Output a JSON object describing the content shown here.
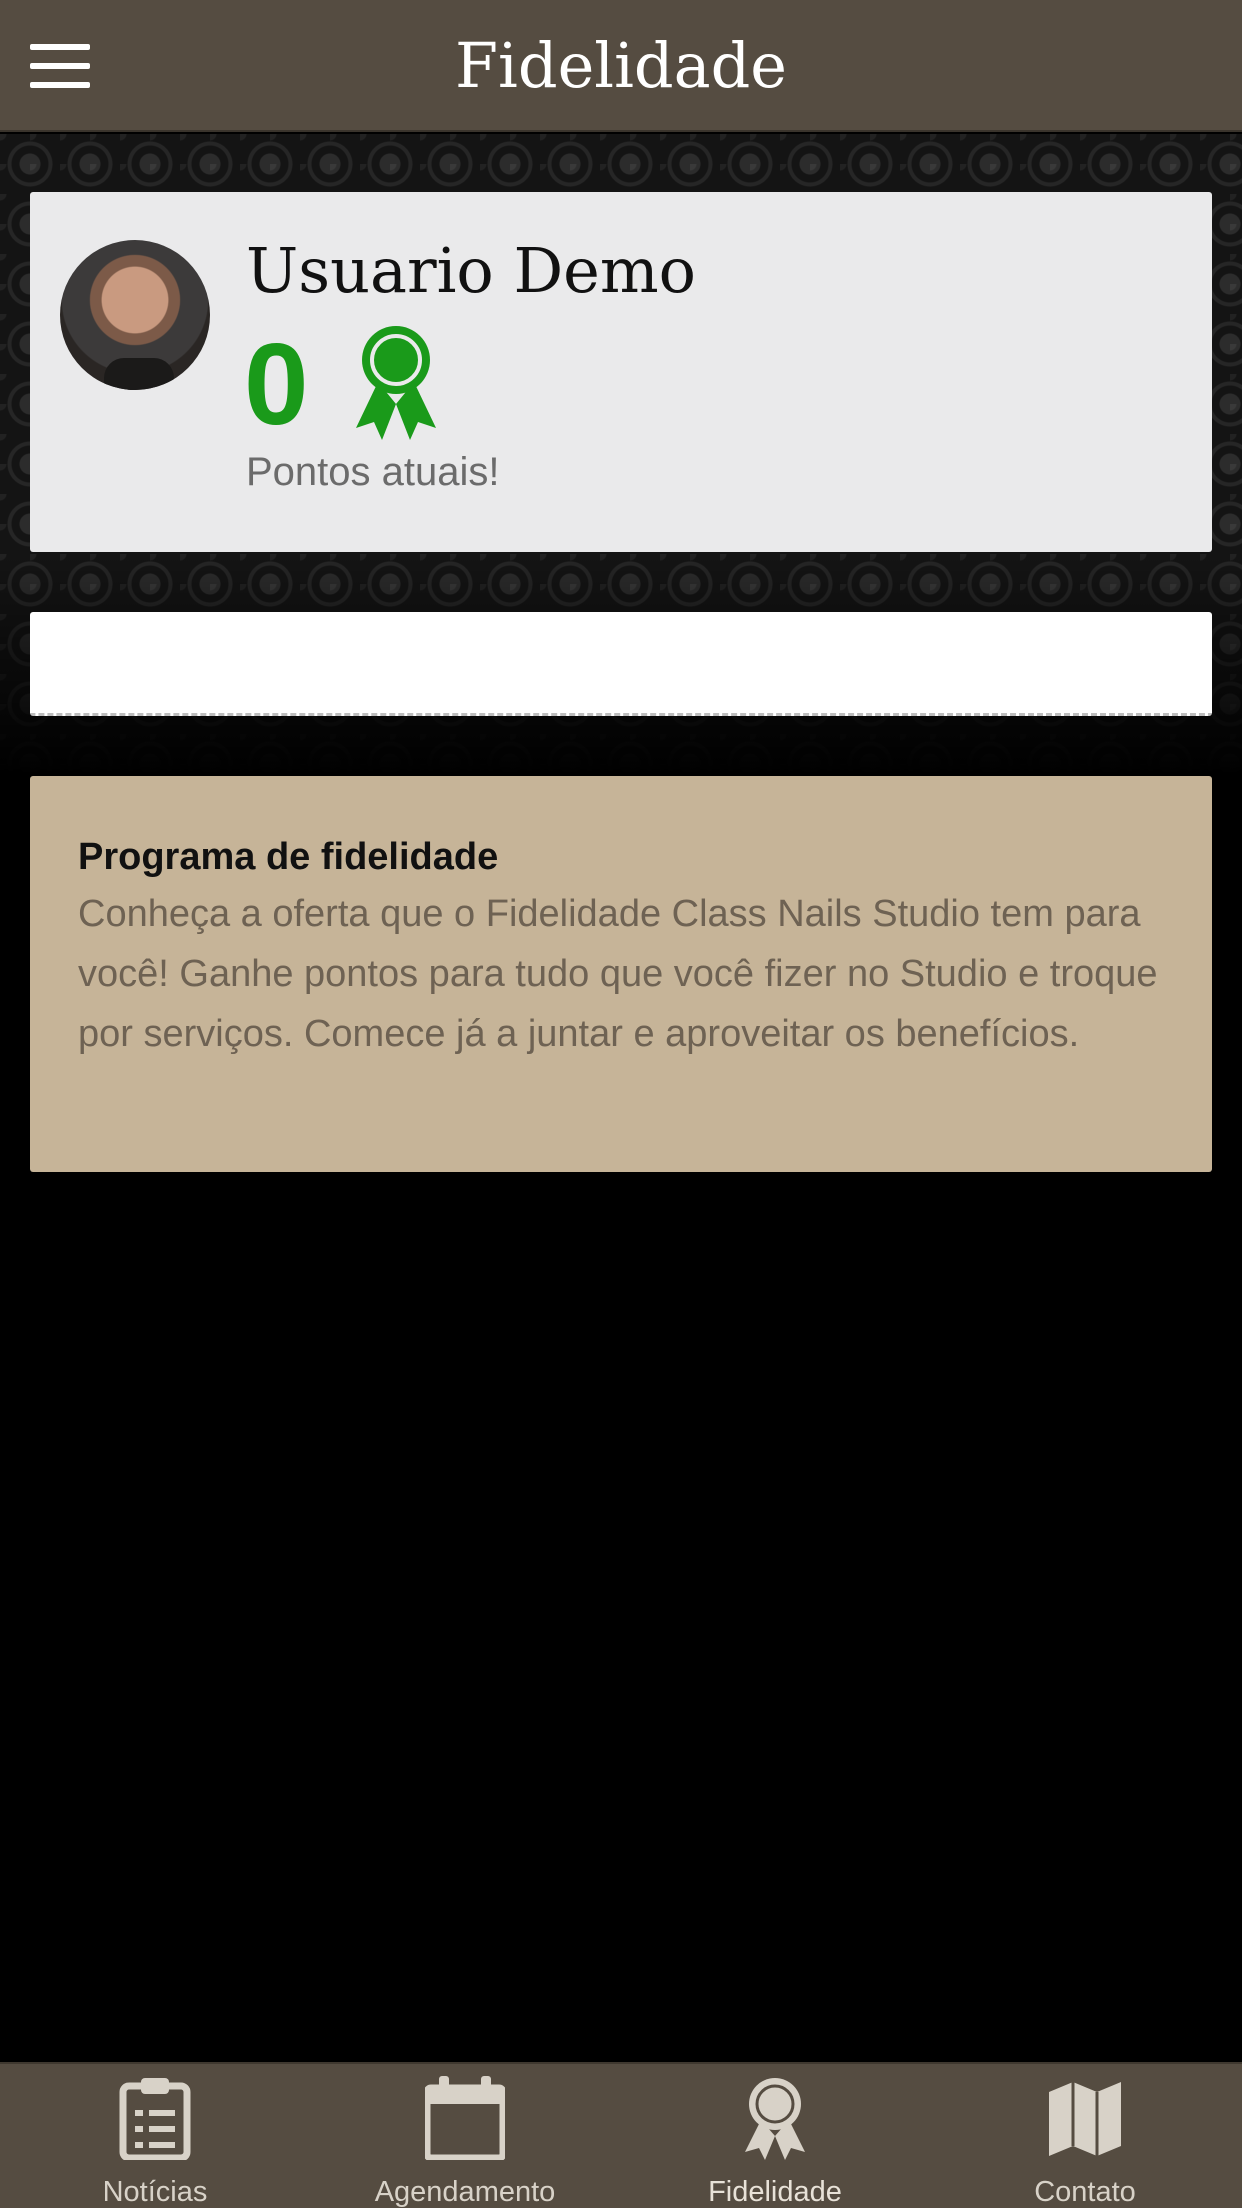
{
  "header": {
    "title": "Fidelidade",
    "menu_icon": "hamburger-menu-icon"
  },
  "profile": {
    "name": "Usuario Demo",
    "points": "0",
    "points_label": "Pontos atuais!",
    "award_icon": "award-ribbon-icon",
    "accent_color": "#1a9a1a"
  },
  "info": {
    "title": "Programa de fidelidade",
    "text": "Conheça a oferta que o Fidelidade Class Nails Studio tem para você! Ganhe pontos para tudo que você fizer no Studio e troque por serviços. Comece já a juntar e aproveitar os benefícios."
  },
  "tabs": [
    {
      "label": "Notícias",
      "icon": "clipboard-icon"
    },
    {
      "label": "Agendamento",
      "icon": "calendar-icon"
    },
    {
      "label": "Fidelidade",
      "icon": "award-icon",
      "active": true
    },
    {
      "label": "Contato",
      "icon": "map-icon"
    }
  ],
  "colors": {
    "header_bg": "#554c41",
    "info_card_bg": "#c6b498",
    "profile_card_bg": "#eaeaeb"
  }
}
